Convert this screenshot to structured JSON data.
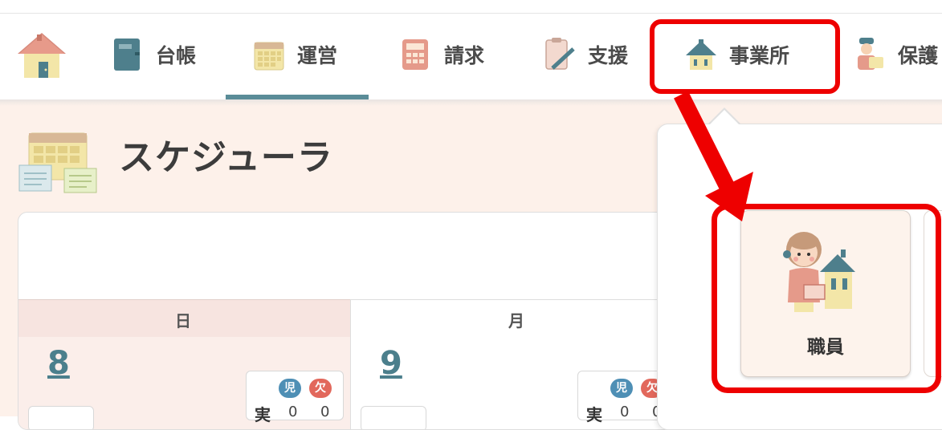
{
  "nav": {
    "items": [
      {
        "key": "ledger",
        "label": "台帳",
        "icon": "ledger-book-icon"
      },
      {
        "key": "operation",
        "label": "運営",
        "icon": "calendar-icon",
        "active": true
      },
      {
        "key": "billing",
        "label": "請求",
        "icon": "calculator-icon"
      },
      {
        "key": "support",
        "label": "支援",
        "icon": "clipboard-pencil-icon"
      },
      {
        "key": "office",
        "label": "事業所",
        "icon": "office-house-icon"
      },
      {
        "key": "guardian",
        "label": "保護",
        "icon": "guardian-icon"
      }
    ],
    "home_icon": "home-icon"
  },
  "page": {
    "title": "スケジューラ",
    "icon": "scheduler-icon"
  },
  "calendar": {
    "weekdays": [
      "日",
      "月"
    ],
    "days": [
      {
        "date": "8",
        "badges": [
          "児",
          "欠"
        ],
        "row_label": "実",
        "values": [
          "0",
          "0"
        ]
      },
      {
        "date": "9",
        "badges": [
          "児",
          "欠"
        ],
        "row_label": "実",
        "values": [
          "0",
          "0"
        ]
      }
    ]
  },
  "popup": {
    "items": [
      {
        "label": "職員",
        "icon": "staff-office-icon"
      }
    ]
  },
  "colors": {
    "accent": "#5a8c98",
    "highlight": "#ee0000",
    "content_bg": "#fdf1ea",
    "child_badge": "#4e8fb5",
    "absent_badge": "#e2685c"
  }
}
